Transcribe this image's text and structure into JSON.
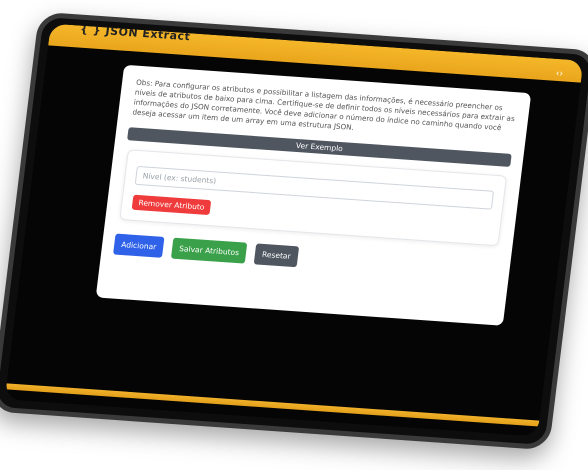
{
  "app": {
    "title": "{ } JSON Extract"
  },
  "card": {
    "note": "Obs: Para configurar os atributos e possibilitar a listagem das informações, é necessário preencher os níveis de atributos de baixo para cima. Certifique-se de definir todos os níveis necessários para extrair as informações do JSON corretamente. Você deve adicionar o número do índice no caminho quando você deseja acessar um item de um array em uma estrutura JSON.",
    "example_button": "Ver Exemplo",
    "level_placeholder": "Nível (ex: students)",
    "remove_button": "Remover Atributo"
  },
  "actions": {
    "add": "Adicionar",
    "save": "Salvar Atributos",
    "reset": "Resetar"
  },
  "colors": {
    "accent_bar": "#f5b72a",
    "primary": "#2f62e8",
    "success": "#3aa14a",
    "danger": "#ef3b3b",
    "secondary": "#4f5660"
  },
  "icons": {
    "top_right": "code-icon"
  }
}
